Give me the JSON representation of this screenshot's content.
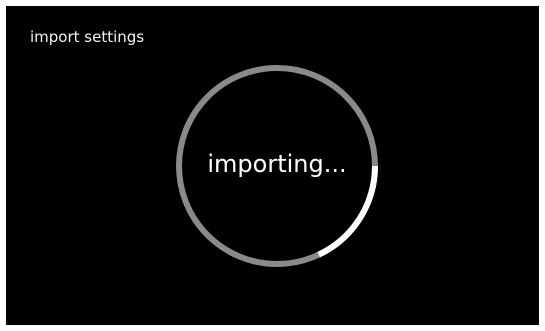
{
  "screen": {
    "title": "import settings",
    "status_text": "importing...",
    "progress": 0.18
  },
  "colors": {
    "background": "#000000",
    "ring_track": "#8a8a8a",
    "ring_progress": "#ffffff",
    "text": "#ffffff"
  }
}
